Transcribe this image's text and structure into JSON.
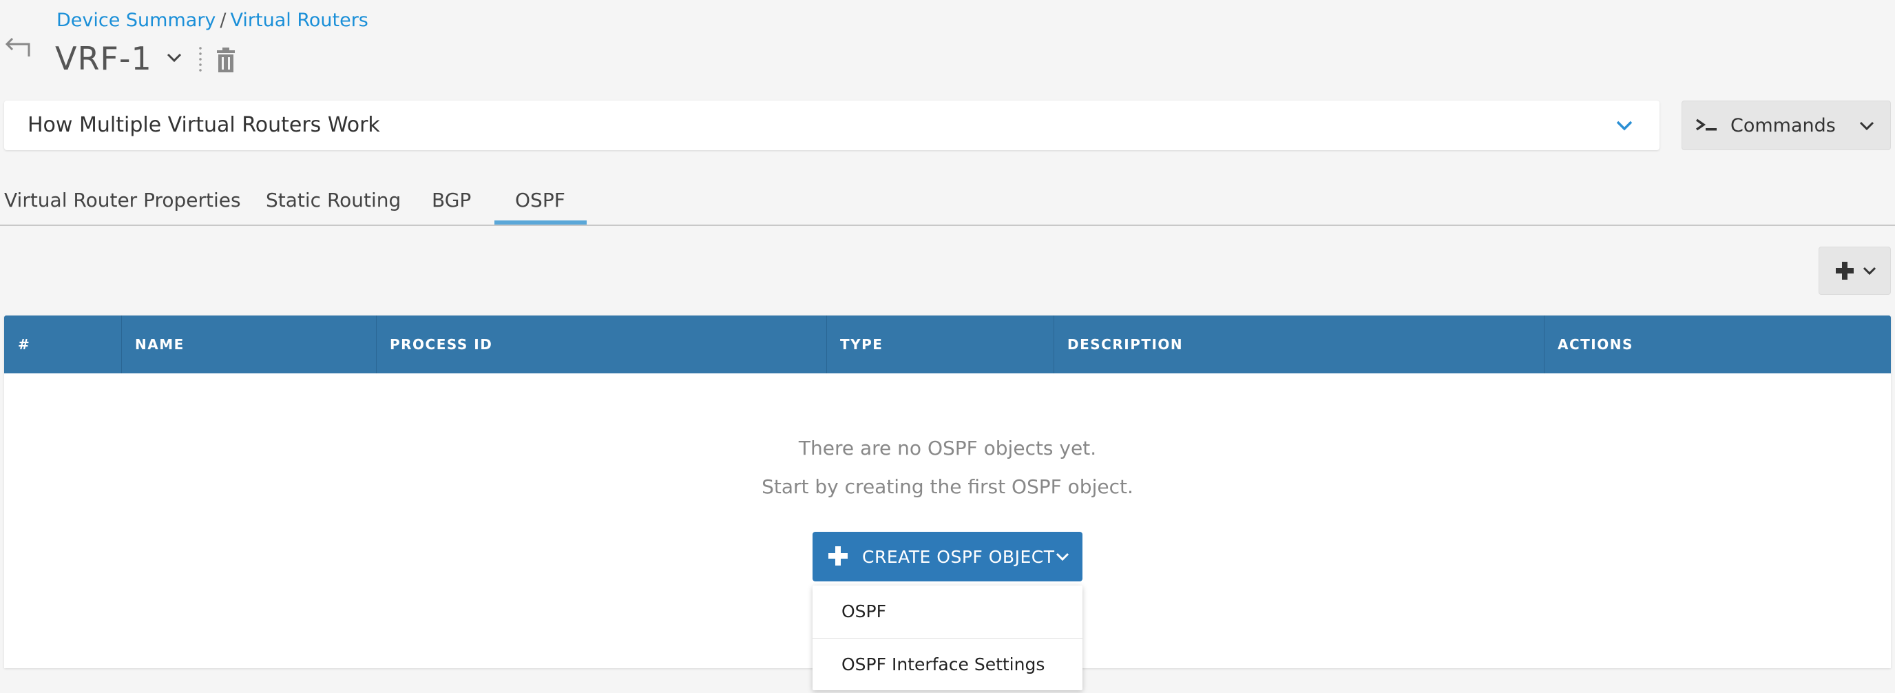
{
  "breadcrumb": {
    "items": [
      "Device Summary",
      "Virtual Routers"
    ],
    "separator": "/"
  },
  "header": {
    "title": "VRF-1",
    "icons": [
      "back-arrow-icon",
      "chevron-down-icon",
      "trash-icon"
    ]
  },
  "help": {
    "label": "How Multiple Virtual Routers Work"
  },
  "commands": {
    "label": "Commands",
    "icon": "terminal-icon"
  },
  "tabs": [
    {
      "label": "Virtual Router Properties",
      "active": false
    },
    {
      "label": "Static Routing",
      "active": false
    },
    {
      "label": "BGP",
      "active": false
    },
    {
      "label": "OSPF",
      "active": true
    }
  ],
  "table": {
    "columns": [
      "#",
      "NAME",
      "PROCESS ID",
      "TYPE",
      "DESCRIPTION",
      "ACTIONS"
    ],
    "rows": [],
    "empty_line1": "There are no OSPF objects yet.",
    "empty_line2": "Start by creating the first OSPF object."
  },
  "create_button": {
    "label": "CREATE OSPF OBJECT"
  },
  "dropdown_menu": {
    "items": [
      "OSPF",
      "OSPF Interface Settings"
    ]
  },
  "colors": {
    "link": "#1a8fd8",
    "table_header": "#3477a9",
    "primary_button": "#2e7ab8",
    "active_tab": "#5aa7d8"
  }
}
